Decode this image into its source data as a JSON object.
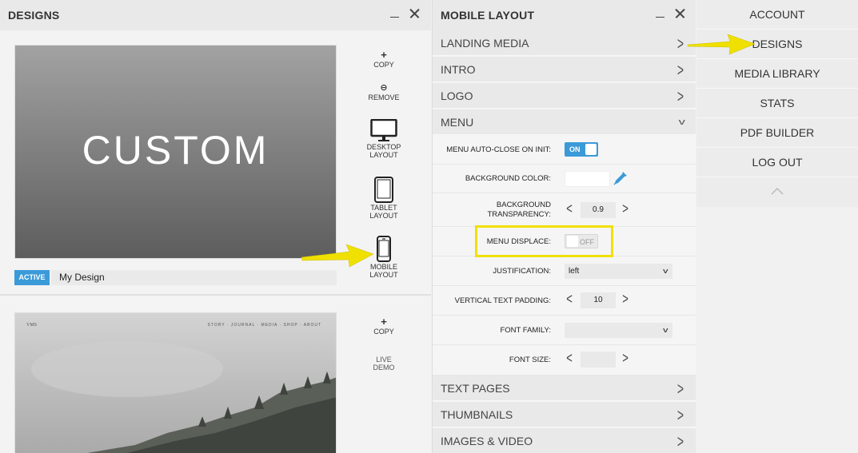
{
  "designs_panel": {
    "title": "DESIGNS",
    "cards": [
      {
        "thumbnail_text": "CUSTOM",
        "status_badge": "ACTIVE",
        "name": "My Design",
        "actions": {
          "copy": "COPY",
          "remove": "REMOVE",
          "desktop_line1": "DESKTOP",
          "desktop_line2": "LAYOUT",
          "tablet_line1": "TABLET",
          "tablet_line2": "LAYOUT",
          "mobile_line1": "MOBILE",
          "mobile_line2": "LAYOUT"
        }
      },
      {
        "actions": {
          "copy": "COPY",
          "live_demo_line1": "LIVE",
          "live_demo_line2": "DEMO"
        }
      }
    ]
  },
  "mobile_panel": {
    "title": "MOBILE LAYOUT",
    "sections_top": [
      "LANDING MEDIA",
      "INTRO",
      "LOGO"
    ],
    "menu_section": "MENU",
    "settings": {
      "auto_close_label": "MENU AUTO-CLOSE ON INIT:",
      "auto_close_value": "ON",
      "bg_color_label": "BACKGROUND COLOR:",
      "bg_transparency_line1": "BACKGROUND",
      "bg_transparency_line2": "TRANSPARENCY:",
      "bg_transparency_value": "0.9",
      "displace_label": "MENU DISPLACE:",
      "displace_value": "OFF",
      "justification_label": "JUSTIFICATION:",
      "justification_value": "left",
      "vpad_label": "VERTICAL TEXT PADDING:",
      "vpad_value": "10",
      "font_family_label": "FONT FAMILY:",
      "font_family_value": "",
      "font_size_label": "FONT SIZE:",
      "font_size_value": ""
    },
    "sections_bottom": [
      "TEXT PAGES",
      "THUMBNAILS",
      "IMAGES & VIDEO"
    ]
  },
  "main_nav": {
    "items": [
      "ACCOUNT",
      "DESIGNS",
      "MEDIA LIBRARY",
      "STATS",
      "PDF BUILDER",
      "LOG OUT"
    ]
  },
  "colors": {
    "accent": "#3b9ad8",
    "highlight": "#f0e000",
    "arrow": "#f0e000"
  }
}
